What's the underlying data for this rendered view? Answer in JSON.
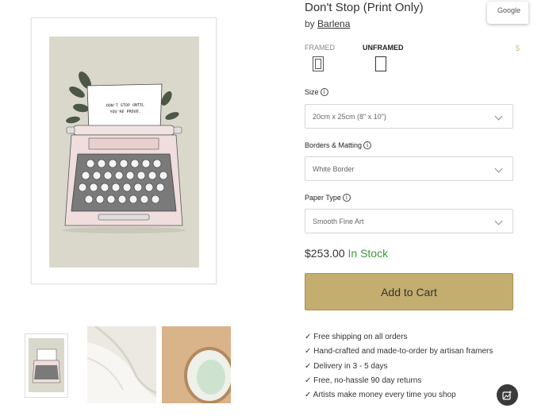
{
  "product": {
    "title": "Don't Stop (Print Only)",
    "by_prefix": "by",
    "artist": "Barlena",
    "artwork_text_line1": "DON'T STOP UNTIL",
    "artwork_text_line2": "YOU'RE PROUD."
  },
  "overlay": {
    "google_badge": "Google",
    "edge_mark": "5"
  },
  "frame_options": {
    "framed_label": "FRAMED",
    "unframed_label": "UNFRAMED",
    "selected": "UNFRAMED"
  },
  "options": {
    "size": {
      "label": "Size",
      "value": "20cm x 25cm (8\" x 10\")"
    },
    "borders": {
      "label": "Borders & Matting",
      "value": "White Border"
    },
    "paper": {
      "label": "Paper Type",
      "value": "Smooth Fine Art"
    }
  },
  "price": {
    "amount": "$253.00",
    "stock": "In Stock"
  },
  "cart": {
    "button_label": "Add to Cart"
  },
  "benefits": [
    "✓ Free shipping on all orders",
    "✓ Hand-crafted and made-to-order by artisan framers",
    "✓ Delivery in 3 - 5 days",
    "✓ Free, no-hassle 90 day returns",
    "✓ Artists make money every time you shop"
  ],
  "icons": {
    "info": "info-icon",
    "chevron": "chevron-down-icon",
    "fab": "image-sparkle-icon"
  },
  "colors": {
    "accent_button": "#c3ad6f",
    "in_stock": "#3a9a3a",
    "artwork_bg": "#d9d8cb"
  }
}
